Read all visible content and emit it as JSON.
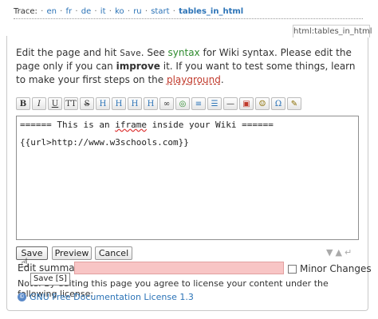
{
  "trace": {
    "label": "Trace:",
    "items": [
      "en",
      "fr",
      "de",
      "it",
      "ko",
      "ru",
      "start"
    ],
    "current": "tables_in_html",
    "separator": "·"
  },
  "page_id": "html:tables_in_html",
  "intro": {
    "part1": "Edit the page and hit ",
    "save_word": "Save",
    "part2": ". See ",
    "syntax_link": "syntax",
    "part3": " for Wiki syntax. Please edit the page only if you can ",
    "improve_word": "improve",
    "part4": " it. If you want to test some things, learn to make your first steps on the ",
    "playground_link": "playground",
    "part5": "."
  },
  "toolbar": {
    "buttons": [
      {
        "label": "B",
        "icon": "bold-icon"
      },
      {
        "label": "I",
        "icon": "italic-icon"
      },
      {
        "label": "U",
        "icon": "underline-icon"
      },
      {
        "label": "TT",
        "icon": "code-icon"
      },
      {
        "label": "S",
        "icon": "strikethrough-icon"
      },
      {
        "label": "H",
        "icon": "heading-same-icon"
      },
      {
        "label": "H",
        "icon": "heading-lower-icon"
      },
      {
        "label": "H",
        "icon": "heading-higher-icon"
      },
      {
        "label": "H",
        "icon": "headline-menu-icon"
      },
      {
        "label": "∞",
        "icon": "internal-link-icon"
      },
      {
        "label": "◎",
        "icon": "external-link-icon"
      },
      {
        "label": "≡",
        "icon": "ordered-list-icon"
      },
      {
        "label": "☰",
        "icon": "unordered-list-icon"
      },
      {
        "label": "—",
        "icon": "horizontal-rule-icon"
      },
      {
        "label": "▣",
        "icon": "media-icon"
      },
      {
        "label": "☺",
        "icon": "smiley-icon"
      },
      {
        "label": "Ω",
        "icon": "special-chars-icon"
      },
      {
        "label": "✎",
        "icon": "signature-icon"
      }
    ]
  },
  "editor": {
    "line1_prefix": "====== This is an ",
    "line1_word": "iframe",
    "line1_suffix": " inside your Wiki ======",
    "line2": "{{url>http://www.w3schools.com}}"
  },
  "buttons": {
    "save": "Save",
    "preview": "Preview",
    "cancel": "Cancel"
  },
  "tooltip": "Save [S]",
  "summary": {
    "label": "Edit summary",
    "value": ""
  },
  "minor_changes": "Minor Changes",
  "note": "Note: By editing this page you agree to license your content under the following license:",
  "license": "GNU Free Documentation License 1.3"
}
